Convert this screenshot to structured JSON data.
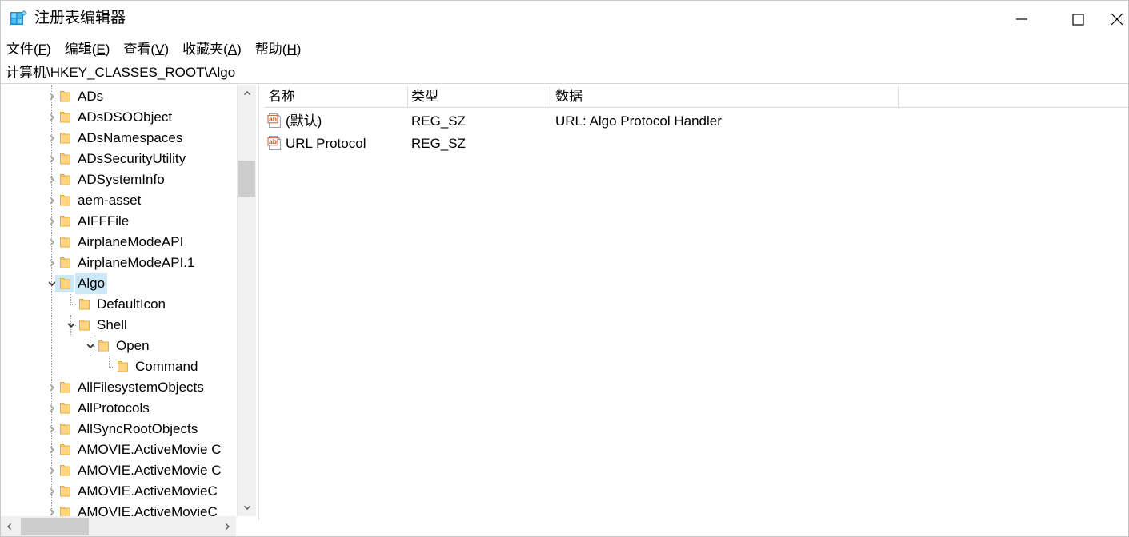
{
  "window": {
    "title": "注册表编辑器",
    "icon": "registry-editor-icon",
    "controls": {
      "minimize": "minimize-icon",
      "maximize": "maximize-icon",
      "close": "close-icon"
    }
  },
  "menubar": {
    "items": [
      {
        "label": "文件(F)",
        "text": "文件(",
        "accel": "F",
        "tail": ")"
      },
      {
        "label": "编辑(E)",
        "text": "编辑(",
        "accel": "E",
        "tail": ")"
      },
      {
        "label": "查看(V)",
        "text": "查看(",
        "accel": "V",
        "tail": ")"
      },
      {
        "label": "收藏夹(A)",
        "text": "收藏夹(",
        "accel": "A",
        "tail": ")"
      },
      {
        "label": "帮助(H)",
        "text": "帮助(",
        "accel": "H",
        "tail": ")"
      }
    ]
  },
  "addressbar": {
    "path": "计算机\\HKEY_CLASSES_ROOT\\Algo"
  },
  "tree": {
    "nodes": [
      {
        "label": "ADs",
        "depth": 0,
        "expander": "collapsed",
        "selected": false
      },
      {
        "label": "ADsDSOObject",
        "depth": 0,
        "expander": "collapsed",
        "selected": false
      },
      {
        "label": "ADsNamespaces",
        "depth": 0,
        "expander": "collapsed",
        "selected": false
      },
      {
        "label": "ADsSecurityUtility",
        "depth": 0,
        "expander": "collapsed",
        "selected": false
      },
      {
        "label": "ADSystemInfo",
        "depth": 0,
        "expander": "collapsed",
        "selected": false
      },
      {
        "label": "aem-asset",
        "depth": 0,
        "expander": "collapsed",
        "selected": false
      },
      {
        "label": "AIFFFile",
        "depth": 0,
        "expander": "collapsed",
        "selected": false
      },
      {
        "label": "AirplaneModeAPI",
        "depth": 0,
        "expander": "collapsed",
        "selected": false
      },
      {
        "label": "AirplaneModeAPI.1",
        "depth": 0,
        "expander": "collapsed",
        "selected": false
      },
      {
        "label": "Algo",
        "depth": 0,
        "expander": "expanded",
        "selected": true
      },
      {
        "label": "DefaultIcon",
        "depth": 1,
        "expander": "none",
        "selected": false
      },
      {
        "label": "Shell",
        "depth": 1,
        "expander": "expanded",
        "selected": false
      },
      {
        "label": "Open",
        "depth": 2,
        "expander": "expanded",
        "selected": false
      },
      {
        "label": "Command",
        "depth": 3,
        "expander": "none",
        "selected": false
      },
      {
        "label": "AllFilesystemObjects",
        "depth": 0,
        "expander": "collapsed",
        "selected": false
      },
      {
        "label": "AllProtocols",
        "depth": 0,
        "expander": "collapsed",
        "selected": false
      },
      {
        "label": "AllSyncRootObjects",
        "depth": 0,
        "expander": "collapsed",
        "selected": false
      },
      {
        "label": "AMOVIE.ActiveMovie C",
        "depth": 0,
        "expander": "collapsed",
        "selected": false
      },
      {
        "label": "AMOVIE.ActiveMovie C",
        "depth": 0,
        "expander": "collapsed",
        "selected": false
      },
      {
        "label": "AMOVIE.ActiveMovieC",
        "depth": 0,
        "expander": "collapsed",
        "selected": false
      },
      {
        "label": "AMOVIE.ActiveMovieC",
        "depth": 0,
        "expander": "collapsed",
        "selected": false
      }
    ],
    "scrollbars": {
      "vertical_up": "scroll-up-icon",
      "vertical_down": "scroll-down-icon",
      "horizontal_left": "scroll-left-icon",
      "horizontal_right": "scroll-right-icon"
    }
  },
  "listview": {
    "columns": [
      "名称",
      "类型",
      "数据"
    ],
    "rows": [
      {
        "name": "(默认)",
        "type": "REG_SZ",
        "data": "URL: Algo Protocol Handler",
        "icon": "string-value-icon"
      },
      {
        "name": "URL Protocol",
        "type": "REG_SZ",
        "data": "",
        "icon": "string-value-icon"
      }
    ]
  },
  "colors": {
    "selection": "#cce8f7",
    "folder": "#ffd67e",
    "folder_tab": "#ffe7b0",
    "value_icon": "#d9471f",
    "scroll_thumb": "#cdcdcd",
    "scroll_track": "#f0f0f0",
    "divider": "#dcdcdc"
  }
}
